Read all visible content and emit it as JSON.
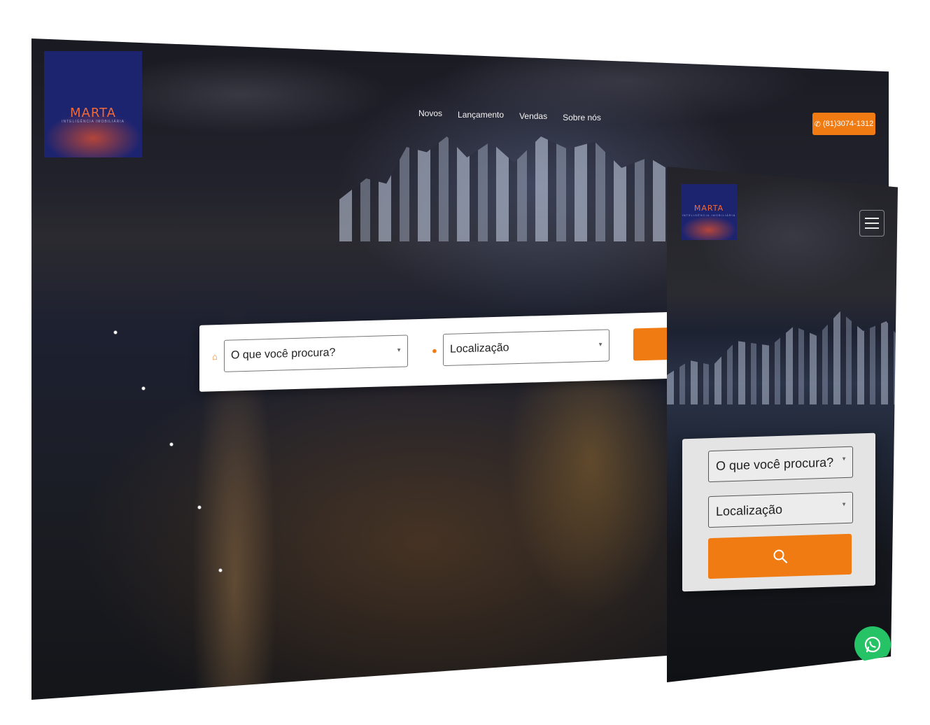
{
  "brand": {
    "logo_text": "MARTA",
    "logo_sub": "INTELIGÊNCIA IMOBILIÁRIA",
    "logo_bg": "#1c2470",
    "accent": "#f07b12"
  },
  "desktop": {
    "nav": [
      "Novos",
      "Lançamento",
      "Vendas",
      "Sobre nós"
    ],
    "phone": "(81)3074-1312",
    "search": {
      "what_placeholder": "O que você procura?",
      "where_placeholder": "Localização"
    }
  },
  "mobile": {
    "menu_icon": "hamburger-icon",
    "search": {
      "what_placeholder": "O que você procura?",
      "where_placeholder": "Localização",
      "button_icon": "search-icon"
    },
    "whatsapp_icon": "whatsapp-icon"
  }
}
